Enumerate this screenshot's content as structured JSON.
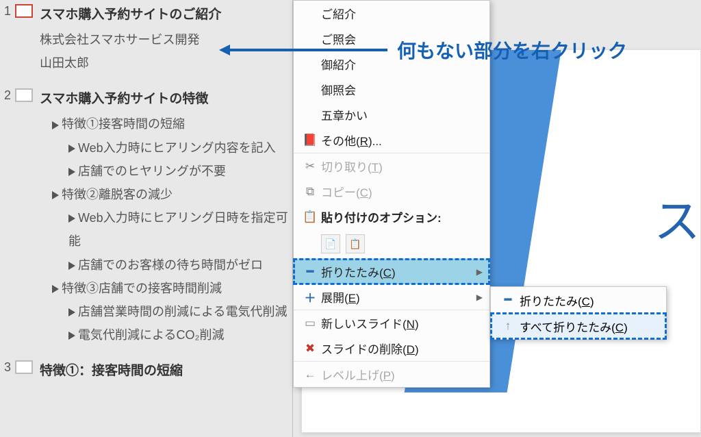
{
  "annotation": {
    "text": "何もない部分を右クリック"
  },
  "outline": {
    "slide1": {
      "num": "1",
      "title": "スマホ購入予約サイトのご紹介",
      "lines": [
        "株式会社スマホサービス開発",
        "山田太郎"
      ]
    },
    "slide2": {
      "num": "2",
      "title": "スマホ購入予約サイトの特徴",
      "b1": "特徴①接客時間の短縮",
      "b1a": "Web入力時にヒアリング内容を記入",
      "b1b": "店舗でのヒヤリングが不要",
      "b2": "特徴②離脱客の減少",
      "b2a": "Web入力時にヒアリング日時を指定可能",
      "b2b": "店舗でのお客様の待ち時間がゼロ",
      "b3": "特徴③店舗での接客時間削減",
      "b3a": "店舗営業時間の削減による電気代削減",
      "b3b": "電気代削減によるCO₂削減"
    },
    "slide3": {
      "num": "3",
      "title": "特徴①：接客時間の短縮"
    }
  },
  "canvas": {
    "partial_text": "ス"
  },
  "ctx": {
    "ime1": "ご紹介",
    "ime2": "ご照会",
    "ime3": "御紹介",
    "ime4": "御照会",
    "ime5": "五章かい",
    "other": "その他(R)...",
    "cut": "切り取り(T)",
    "copy": "コピー(C)",
    "paste_opts": "貼り付けのオプション:",
    "collapse": "折りたたみ(C)",
    "expand": "展開(E)",
    "new_slide": "新しいスライド(N)",
    "delete_slide": "スライドの削除(D)",
    "promote": "レベル上げ(P)"
  },
  "sub": {
    "collapse": "折りたたみ(C)",
    "collapse_all": "すべて折りたたみ(C)"
  }
}
